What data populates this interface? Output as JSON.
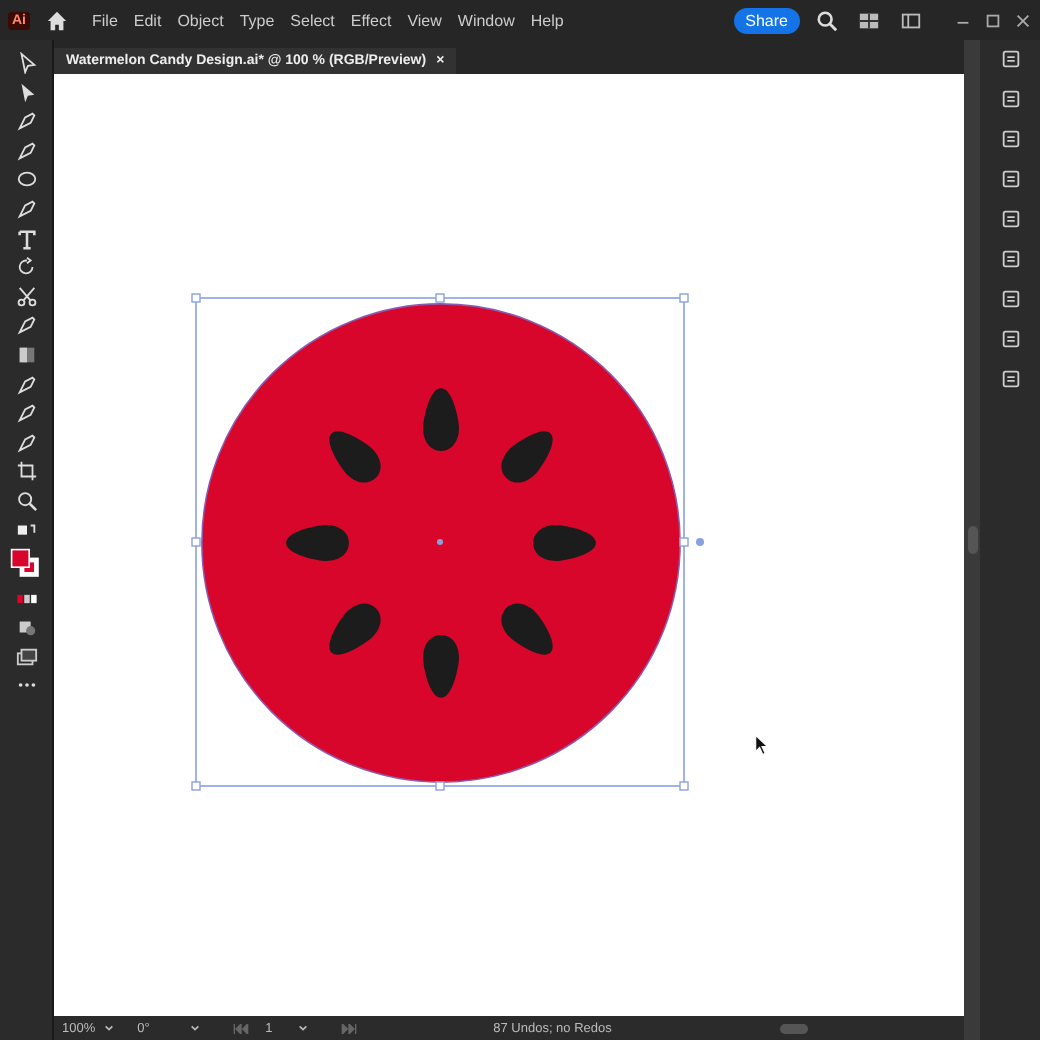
{
  "app": {
    "logo": "Ai"
  },
  "menu": [
    "File",
    "Edit",
    "Object",
    "Type",
    "Select",
    "Effect",
    "View",
    "Window",
    "Help"
  ],
  "share_button": "Share",
  "document_tab": {
    "title": "Watermelon Candy Design.ai* @ 100 % (RGB/Preview)",
    "close": "×"
  },
  "artwork": {
    "kind": "watermelon-slice",
    "selected": true
  },
  "status_bar": {
    "zoom": "100%",
    "rotation": "0°",
    "artboard": "1",
    "history": "87 Undos; no Redos"
  }
}
